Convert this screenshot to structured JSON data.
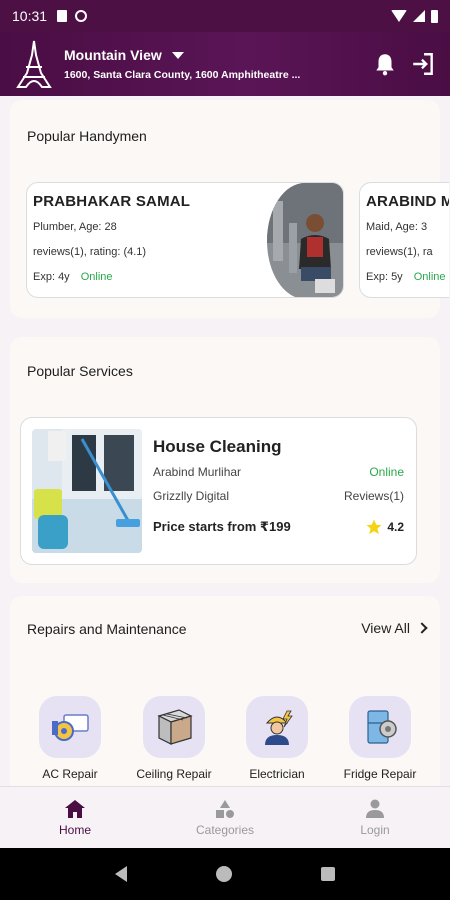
{
  "status_bar": {
    "time": "10:31"
  },
  "header": {
    "city": "Mountain View",
    "address": "1600, Santa Clara County, 1600 Amphitheatre ..."
  },
  "popular_handymen": {
    "title": "Popular Handymen",
    "cards": [
      {
        "name": "PRABHAKAR SAMAL",
        "role_age": "Plumber, Age: 28",
        "reviews_rating": "reviews(1), rating: (4.1)",
        "exp": "Exp: 4y",
        "status": "Online"
      },
      {
        "name": "ARABIND MURLIHAR",
        "role_age": "Maid, Age: 3",
        "reviews_rating": "reviews(1), ra",
        "exp": "Exp: 5y",
        "status": "Online"
      }
    ]
  },
  "popular_services": {
    "title": "Popular Services",
    "card": {
      "title": "House Cleaning",
      "provider": "Arabind Murlihar",
      "status": "Online",
      "company": "Grizzlly Digital",
      "reviews": "Reviews(1)",
      "price": "Price starts from ₹199",
      "rating": "4.2"
    }
  },
  "repairs": {
    "title": "Repairs and Maintenance",
    "view_all": "View All",
    "categories": [
      {
        "label": "AC Repair",
        "icon": "ac-repair-icon"
      },
      {
        "label": "Ceiling Repair",
        "icon": "ceiling-repair-icon"
      },
      {
        "label": "Electrician",
        "icon": "electrician-icon"
      },
      {
        "label": "Fridge Repair",
        "icon": "fridge-repair-icon"
      }
    ]
  },
  "bottom_nav": {
    "items": [
      {
        "label": "Home",
        "icon": "home-icon",
        "active": true
      },
      {
        "label": "Categories",
        "icon": "categories-icon",
        "active": false
      },
      {
        "label": "Login",
        "icon": "person-icon",
        "active": false
      }
    ]
  },
  "colors": {
    "brand": "#4a0d44",
    "online": "#2aa84a",
    "category_bubble": "#e6e2f4"
  }
}
